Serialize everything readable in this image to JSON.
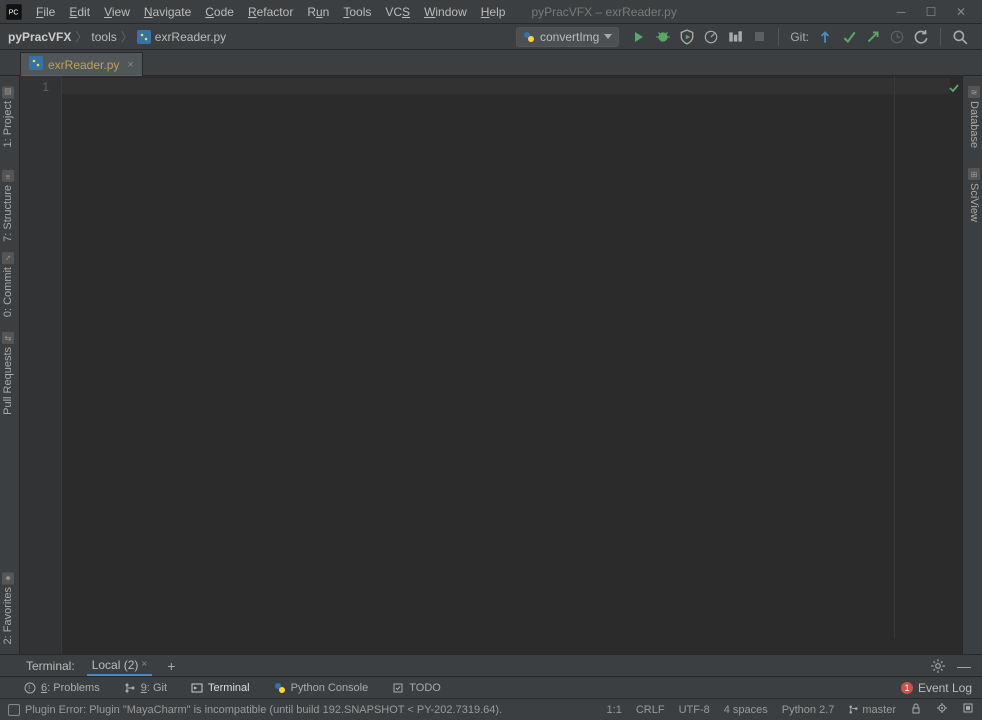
{
  "window": {
    "title": "pyPracVFX – exrReader.py"
  },
  "menu": {
    "file": "File",
    "edit": "Edit",
    "view": "View",
    "navigate": "Navigate",
    "code": "Code",
    "refactor": "Refactor",
    "run": "Run",
    "tools": "Tools",
    "vcs": "VCS",
    "window": "Window",
    "help": "Help"
  },
  "breadcrumb": {
    "root": "pyPracVFX",
    "mid": "tools",
    "file": "exrReader.py"
  },
  "runconfig": {
    "name": "convertImg"
  },
  "git_label": "Git:",
  "editor_tab": {
    "name": "exrReader.py"
  },
  "gutter": {
    "line1": "1"
  },
  "left_tools": {
    "project": "1: Project",
    "structure": "7: Structure",
    "commit": "0: Commit",
    "pullreq": "Pull Requests",
    "favorites": "2: Favorites"
  },
  "right_tools": {
    "database": "Database",
    "sciview": "SciView"
  },
  "terminal": {
    "label": "Terminal:",
    "tab": "Local (2)"
  },
  "bottom": {
    "problems": "6: Problems",
    "git": "9: Git",
    "terminal": "Terminal",
    "pyconsole": "Python Console",
    "todo": "TODO",
    "eventlog": "Event Log"
  },
  "status": {
    "msg": "Plugin Error: Plugin \"MayaCharm\" is incompatible (until build 192.SNAPSHOT < PY-202.7319.64).",
    "pos": "1:1",
    "le": "CRLF",
    "enc": "UTF-8",
    "indent": "4 spaces",
    "interp": "Python 2.7",
    "branch": "master"
  }
}
